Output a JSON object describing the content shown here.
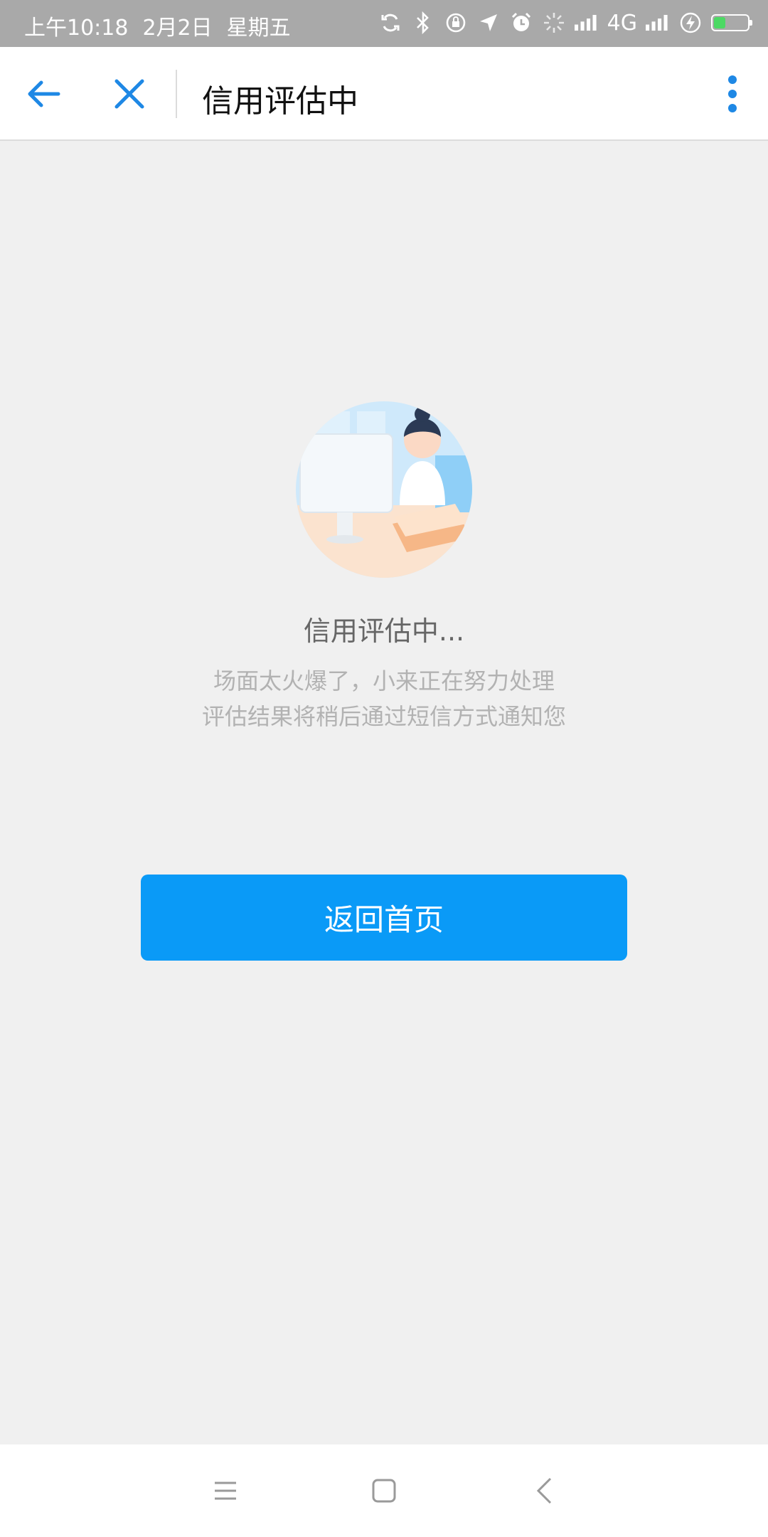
{
  "status_bar": {
    "time": "上午10:18",
    "date": "2月2日",
    "weekday": "星期五",
    "network": "4G",
    "battery_level": 0.35,
    "icons": [
      "sync-icon",
      "bluetooth-icon",
      "rotation-lock-icon",
      "location-icon",
      "alarm-icon",
      "loading-icon",
      "signal-icon",
      "signal-icon",
      "charging-icon",
      "battery-icon"
    ]
  },
  "nav": {
    "title": "信用评估中",
    "accent_color": "#1e88e5"
  },
  "main": {
    "status_title": "信用评估中...",
    "desc_line1": "场面太火爆了，小来正在努力处理",
    "desc_line2": "评估结果将稍后通过短信方式通知您",
    "button_label": "返回首页",
    "button_color": "#0a9af7"
  }
}
